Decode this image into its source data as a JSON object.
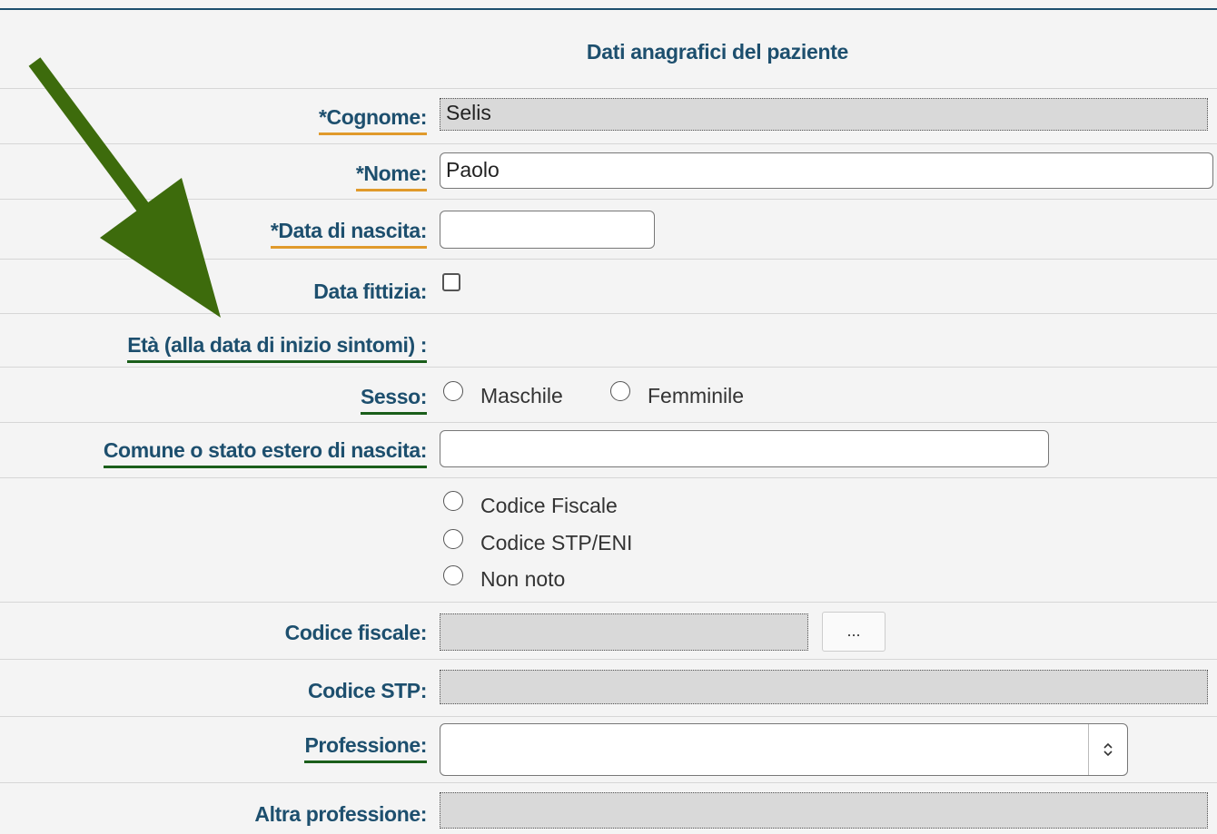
{
  "section_title": "Dati anagrafici del paziente",
  "fields": {
    "cognome": {
      "label": "*Cognome:",
      "value": "Selis"
    },
    "nome": {
      "label": "*Nome:",
      "value": "Paolo"
    },
    "data_nascita": {
      "label": "*Data di nascita:",
      "value": ""
    },
    "data_fittizia": {
      "label": "Data fittizia:",
      "checked": false
    },
    "eta": {
      "label": "Età (alla data di inizio sintomi) :"
    },
    "sesso": {
      "label": "Sesso:",
      "options": [
        "Maschile",
        "Femminile"
      ]
    },
    "comune": {
      "label": "Comune o stato estero di nascita:",
      "value": ""
    },
    "codice_tipo": {
      "options": [
        "Codice Fiscale",
        "Codice STP/ENI",
        "Non noto"
      ]
    },
    "codice_fiscale": {
      "label": "Codice fiscale:",
      "value": "",
      "button": "..."
    },
    "codice_stp": {
      "label": "Codice STP:",
      "value": ""
    },
    "professione": {
      "label": "Professione:",
      "value": ""
    },
    "altra_professione": {
      "label": "Altra professione:",
      "value": ""
    }
  },
  "colors": {
    "label": "#1d4f6e",
    "required_underline": "#e09a2b",
    "link_underline": "#1a5e1a",
    "annotation_arrow": "#3d6b0c"
  }
}
